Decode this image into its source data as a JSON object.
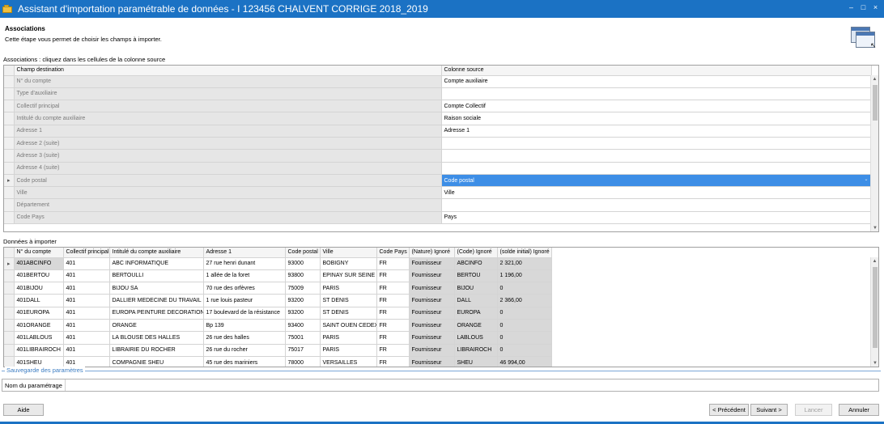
{
  "window": {
    "title": "Assistant d'importation paramétrable de données - I 123456 CHALVENT CORRIGE 2018_2019",
    "controls": [
      "–",
      "□",
      "×"
    ]
  },
  "header": {
    "title": "Associations",
    "description": "Cette étape vous permet de choisir les champs à importer."
  },
  "associations": {
    "label": "Associations : cliquez dans les cellules de la colonne source",
    "col_dest": "Champ destination",
    "col_source": "Colonne source",
    "rows": [
      {
        "dest": "N° du compte",
        "source": "Compte auxiliaire"
      },
      {
        "dest": "Type d'auxiliaire",
        "source": ""
      },
      {
        "dest": "Collectif principal",
        "source": "Compte Collectif"
      },
      {
        "dest": "Intitulé du compte auxiliaire",
        "source": "Raison sociale"
      },
      {
        "dest": "Adresse 1",
        "source": "Adresse 1"
      },
      {
        "dest": "Adresse 2 (suite)",
        "source": ""
      },
      {
        "dest": "Adresse 3 (suite)",
        "source": ""
      },
      {
        "dest": "Adresse 4 (suite)",
        "source": ""
      },
      {
        "dest": "Code postal",
        "source": "Code postal",
        "indicator": "▸"
      },
      {
        "dest": "Ville",
        "source": "Ville"
      },
      {
        "dest": "Département",
        "source": ""
      },
      {
        "dest": "Code Pays",
        "source": "Pays"
      }
    ]
  },
  "donnees": {
    "label": "Données à importer",
    "columns": [
      "N° du compte",
      "Collectif principal",
      "Intitulé du compte auxiliaire",
      "Adresse 1",
      "Code postal",
      "Ville",
      "Code Pays",
      "(Nature) Ignoré",
      "(Code) Ignoré",
      "(solde initial) Ignoré"
    ],
    "rows": [
      {
        "indicator": "▸",
        "cells": [
          "401ABCINFO",
          "401",
          "ABC INFORMATIQUE",
          "27 rue henri dunant",
          "93000",
          "BOBIGNY",
          "FR",
          "Fournisseur",
          "ABCINFO",
          "2 321,00"
        ]
      },
      {
        "cells": [
          "401BERTOU",
          "401",
          "BERTOULLI",
          "1 allée de la foret",
          "93800",
          "EPINAY SUR SEINE",
          "FR",
          "Fournisseur",
          "BERTOU",
          "1 196,00"
        ]
      },
      {
        "cells": [
          "401BIJOU",
          "401",
          "BIJOU SA",
          "70 rue des orfèvres",
          "75009",
          "PARIS",
          "FR",
          "Fournisseur",
          "BIJOU",
          "0"
        ]
      },
      {
        "cells": [
          "401DALL",
          "401",
          "DALLIER MEDECINE DU TRAVAIL",
          "1 rue louis pasteur",
          "93200",
          "ST DENIS",
          "FR",
          "Fournisseur",
          "DALL",
          "2 366,00"
        ]
      },
      {
        "cells": [
          "401EUROPA",
          "401",
          "EUROPA PEINTURE DECORATION",
          "17 boulevard de la résistance",
          "93200",
          "ST DENIS",
          "FR",
          "Fournisseur",
          "EUROPA",
          "0"
        ]
      },
      {
        "cells": [
          "401ORANGE",
          "401",
          "ORANGE",
          "Bp 139",
          "93400",
          "SAINT OUEN CEDEX",
          "FR",
          "Fournisseur",
          "ORANGE",
          "0"
        ]
      },
      {
        "cells": [
          "401LABLOUS",
          "401",
          "LA BLOUSE DES HALLES",
          "26 rue des halles",
          "75001",
          "PARIS",
          "FR",
          "Fournisseur",
          "LABLOUS",
          "0"
        ]
      },
      {
        "cells": [
          "401LIBRAIROCH",
          "401",
          "LIBRAIRIE DU ROCHER",
          "26 rue du rocher",
          "75017",
          "PARIS",
          "FR",
          "Fournisseur",
          "LIBRAIROCH",
          "0"
        ]
      },
      {
        "cells": [
          "401SHEU",
          "401",
          "COMPAGNIE SHEU",
          "45 rue des mariniers",
          "78000",
          "VERSAILLES",
          "FR",
          "Fournisseur",
          "SHEU",
          "46 994,00"
        ]
      }
    ]
  },
  "sauvegarde": {
    "legend": "Sauvegarde des paramètres",
    "nom_label": "Nom du paramétrage",
    "nom_value": ""
  },
  "buttons": {
    "aide": "Aide",
    "precedent": "< Précédent",
    "suivant": "Suivant >",
    "lancer": "Lancer",
    "annuler": "Annuler"
  },
  "colors": {
    "titlebar": "#1b72c4",
    "selection": "#3d8ee6"
  }
}
